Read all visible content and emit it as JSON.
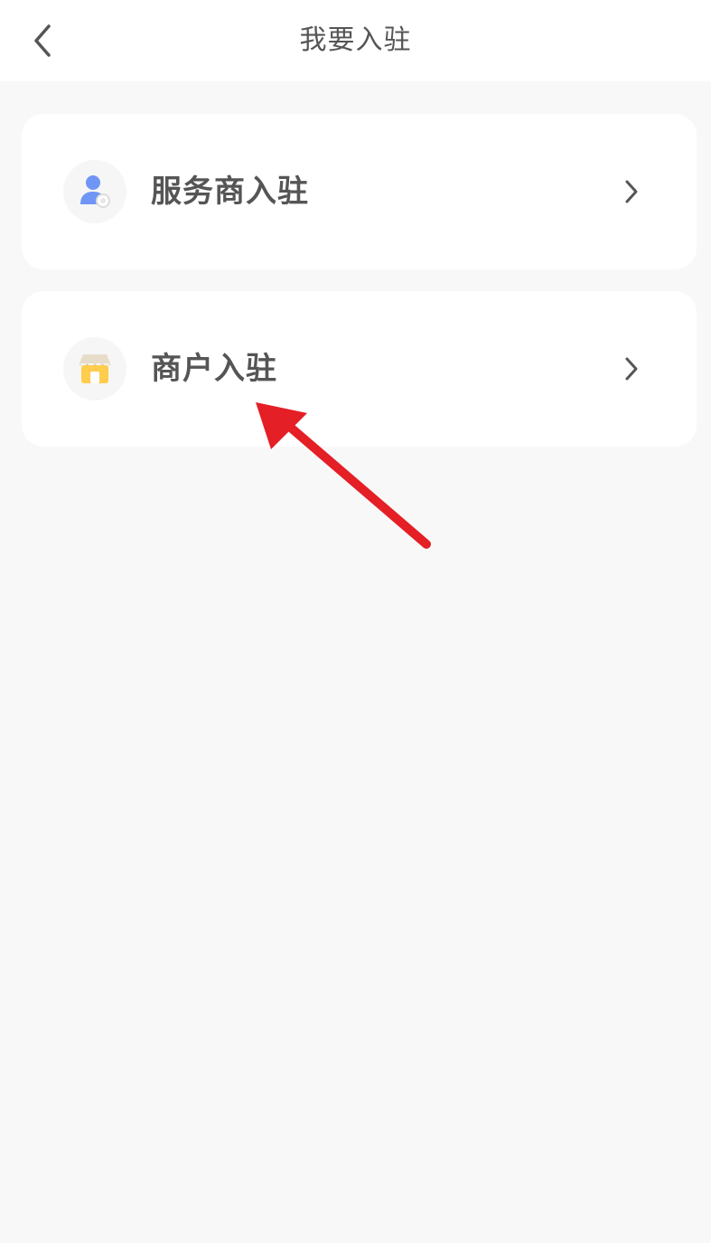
{
  "header": {
    "title": "我要入驻",
    "back_icon": "chevron-left-icon"
  },
  "options": [
    {
      "label": "服务商入驻",
      "icon": "service-provider-icon",
      "arrow_icon": "chevron-right-icon"
    },
    {
      "label": "商户入驻",
      "icon": "storefront-icon",
      "arrow_icon": "chevron-right-icon"
    }
  ],
  "colors": {
    "background": "#f8f8f8",
    "card": "#ffffff",
    "text": "#555555",
    "service_icon_blue": "#6f96f7",
    "store_icon_yellow": "#ffcd4d",
    "annotation_arrow": "#e41f25"
  }
}
